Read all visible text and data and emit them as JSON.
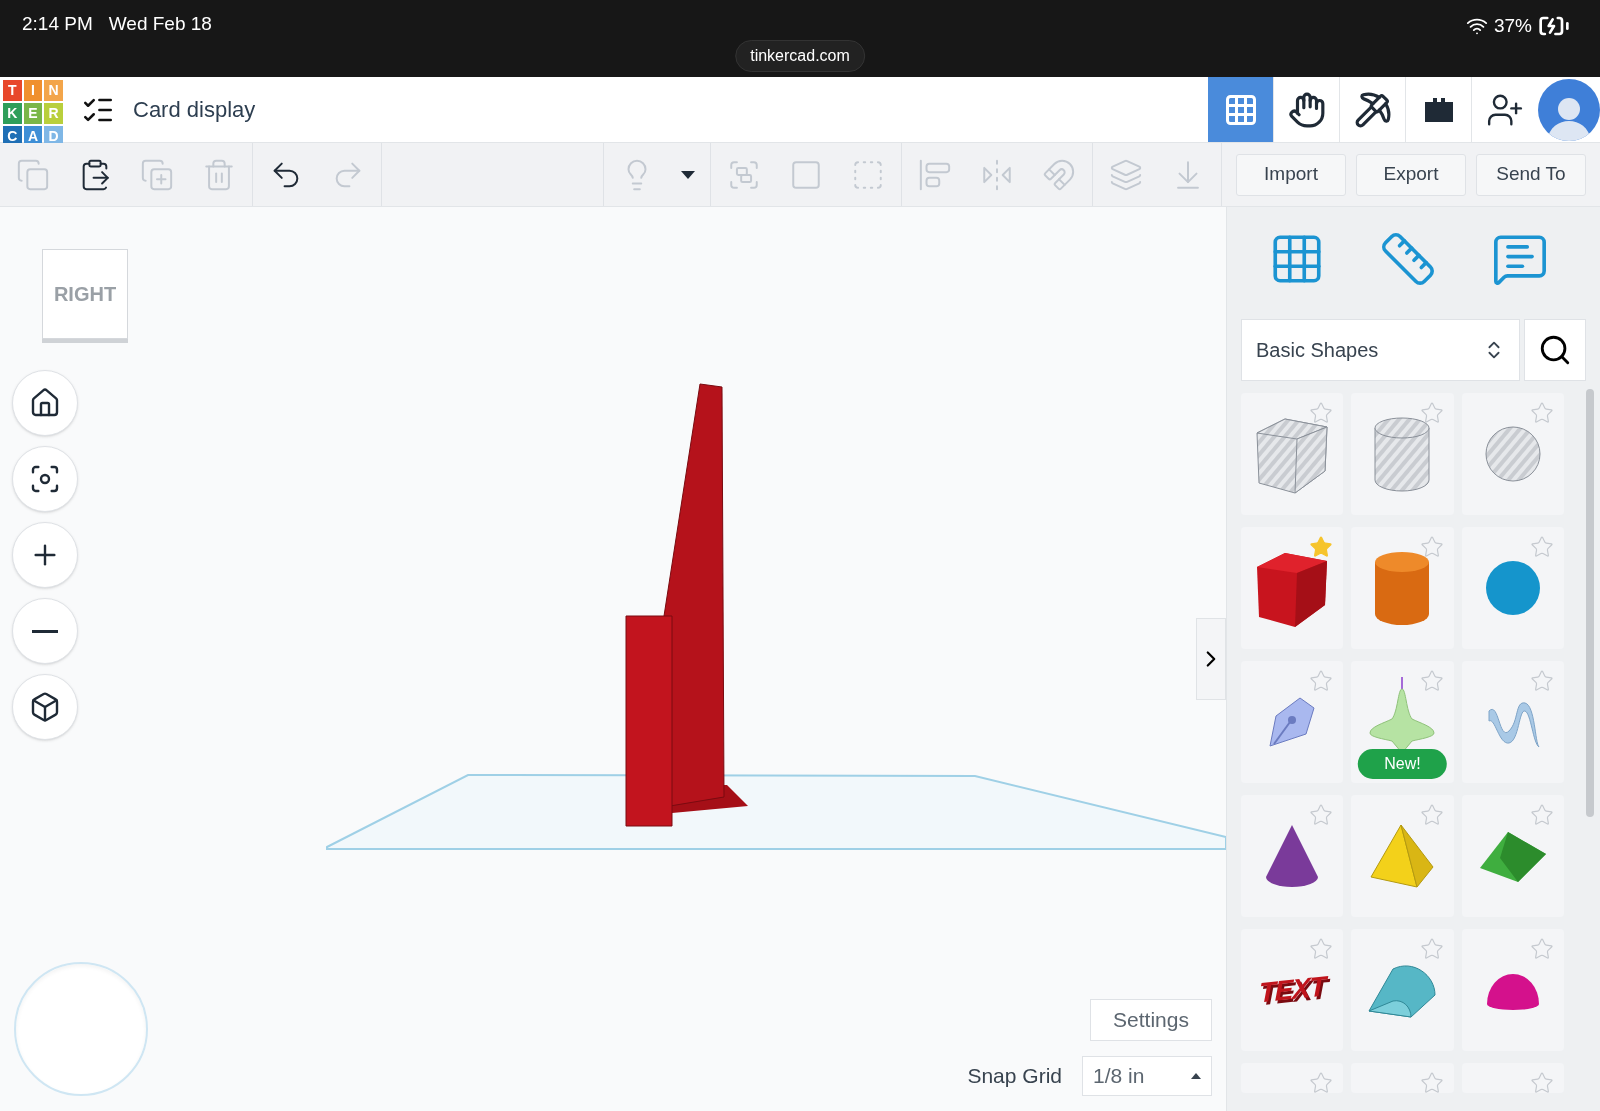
{
  "status_bar": {
    "time": "2:14 PM",
    "date": "Wed Feb 18",
    "url": "tinkercad.com",
    "battery": "37%"
  },
  "header": {
    "logo": [
      {
        "char": "T",
        "color": "#e8472b"
      },
      {
        "char": "I",
        "color": "#f0902e"
      },
      {
        "char": "N",
        "color": "#f3a54a"
      },
      {
        "char": "K",
        "color": "#2f9e5a"
      },
      {
        "char": "E",
        "color": "#7ab648"
      },
      {
        "char": "R",
        "color": "#b9cf3c"
      },
      {
        "char": "C",
        "color": "#1f6fb5"
      },
      {
        "char": "A",
        "color": "#3e8fd6"
      },
      {
        "char": "D",
        "color": "#7fb7e6"
      }
    ],
    "title": "Card display",
    "views": [
      {
        "kind": "grid",
        "selected": true
      },
      {
        "kind": "blocks",
        "selected": false
      },
      {
        "kind": "pickaxe",
        "selected": false
      },
      {
        "kind": "brick",
        "selected": false
      }
    ]
  },
  "toolbar": {
    "groups": [
      [
        {
          "kind": "copy",
          "disabled": true
        },
        {
          "kind": "paste",
          "disabled": false
        },
        {
          "kind": "duplicate",
          "disabled": true
        },
        {
          "kind": "delete",
          "disabled": true
        }
      ],
      [
        {
          "kind": "undo",
          "disabled": false
        },
        {
          "kind": "redo",
          "disabled": true
        }
      ],
      [
        {
          "kind": "light",
          "disabled": true
        },
        {
          "kind": "caret",
          "disabled": false
        }
      ],
      [
        {
          "kind": "group",
          "disabled": true
        },
        {
          "kind": "solid",
          "disabled": true
        },
        {
          "kind": "hole",
          "disabled": true
        }
      ],
      [
        {
          "kind": "align",
          "disabled": true
        },
        {
          "kind": "mirror",
          "disabled": true
        },
        {
          "kind": "magnet",
          "disabled": true
        }
      ],
      [
        {
          "kind": "workplane",
          "disabled": true
        },
        {
          "kind": "drop",
          "disabled": true
        }
      ]
    ],
    "buttons": [
      "Import",
      "Export",
      "Send To"
    ]
  },
  "viewcube": "RIGHT",
  "nav": [
    {
      "kind": "home"
    },
    {
      "kind": "fit"
    },
    {
      "kind": "zoom-in"
    },
    {
      "kind": "zoom-out"
    },
    {
      "kind": "perspective"
    }
  ],
  "settings": "Settings",
  "snap_grid": {
    "label": "Snap Grid",
    "value": "1/8 in"
  },
  "panel": {
    "tools": [
      {
        "kind": "grid"
      },
      {
        "kind": "ruler"
      },
      {
        "kind": "notes"
      }
    ],
    "category": "Basic Shapes",
    "shapes": [
      {
        "kind": "box",
        "hole": true,
        "favorite": false
      },
      {
        "kind": "cylinder",
        "hole": true,
        "favorite": false
      },
      {
        "kind": "sphere",
        "hole": true,
        "favorite": false
      },
      {
        "kind": "box",
        "hole": false,
        "favorite": true
      },
      {
        "kind": "cylinder",
        "hole": false,
        "favorite": false
      },
      {
        "kind": "sphere",
        "hole": false,
        "favorite": false
      },
      {
        "kind": "scribble",
        "favorite": false
      },
      {
        "kind": "spinner",
        "favorite": false,
        "badge": "New!"
      },
      {
        "kind": "squiggle",
        "favorite": false
      },
      {
        "kind": "cone",
        "favorite": false
      },
      {
        "kind": "pyramid",
        "favorite": false
      },
      {
        "kind": "roof",
        "favorite": false
      },
      {
        "kind": "text",
        "favorite": false,
        "label": "TEXT"
      },
      {
        "kind": "half-cylinder",
        "favorite": false
      },
      {
        "kind": "half-sphere",
        "favorite": false
      },
      {
        "kind": "partial",
        "favorite": false
      },
      {
        "kind": "partial",
        "favorite": false
      },
      {
        "kind": "partial",
        "favorite": false
      }
    ]
  }
}
